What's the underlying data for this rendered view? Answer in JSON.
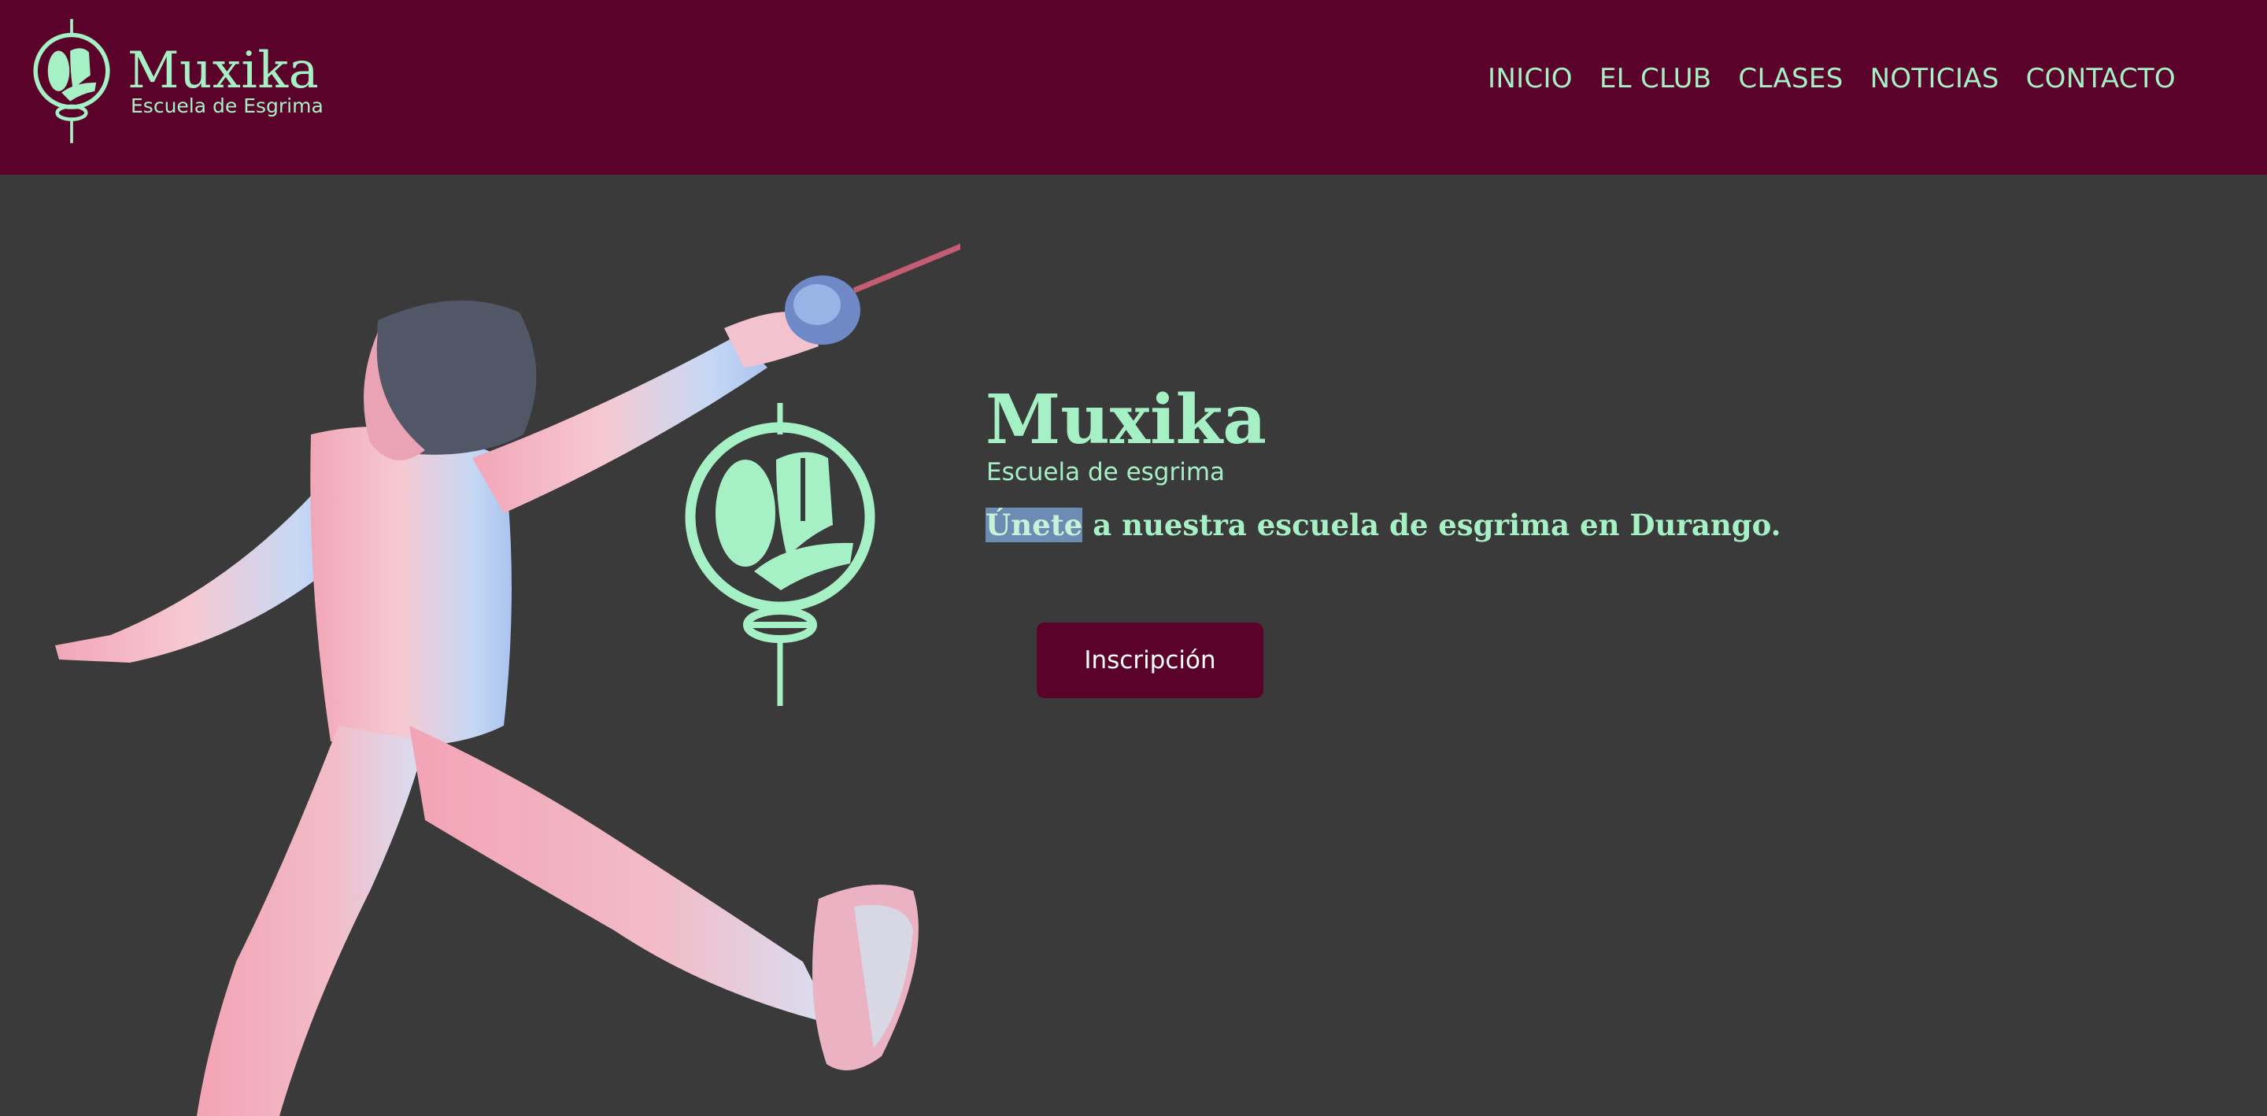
{
  "header": {
    "brand": {
      "name": "Muxika",
      "subtitle": "Escuela de Esgrima",
      "emblem_icon": "fencing-mask-shield-emblem-icon"
    },
    "nav": [
      {
        "label": "INICIO"
      },
      {
        "label": "EL CLUB"
      },
      {
        "label": "CLASES"
      },
      {
        "label": "NOTICIAS"
      },
      {
        "label": "CONTACTO"
      }
    ]
  },
  "hero": {
    "photo": "fencer-lunging-photo",
    "emblem_icon": "fencing-mask-shield-emblem-icon",
    "title": "Muxika",
    "subtitle": "Escuela de esgrima",
    "tagline_highlighted": "Únete",
    "tagline_rest": " a nuestra escuela de esgrima en Durango.",
    "cta_label": "Inscripción"
  },
  "colors": {
    "header_bg": "#5a0229",
    "accent_mint": "#a6f0c5",
    "hero_bg": "#3a3a3a",
    "cta_bg": "#5a0229",
    "cta_text": "#ffffff",
    "selection_highlight": "#6c8cb4"
  }
}
